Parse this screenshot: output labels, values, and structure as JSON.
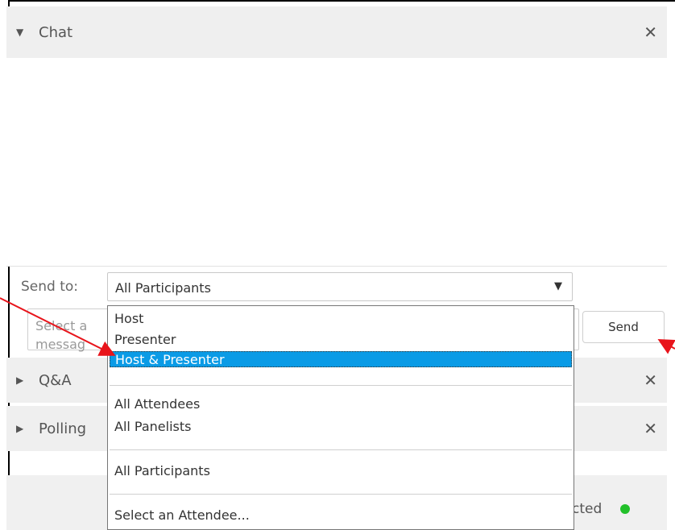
{
  "chat": {
    "title": "Chat",
    "send_to_label": "Send to:",
    "send_to_value": "All Participants",
    "message_placeholder_line1": "Select a",
    "message_placeholder_line2": "messag",
    "send_button": "Send"
  },
  "dropdown": {
    "items": [
      "Host",
      "Presenter",
      "Host & Presenter",
      "All Attendees",
      "All Panelists",
      "All Participants",
      "Select an Attendee..."
    ],
    "selected_item": "Host & Presenter"
  },
  "qa_panel": {
    "title": "Q&A"
  },
  "polling_panel": {
    "title": "Polling"
  },
  "status": {
    "text": "cted"
  },
  "icons": {
    "expanded": "triangle-down-icon",
    "collapsed": "triangle-right-icon",
    "close": "close-icon",
    "caret": "caret-down-icon",
    "status_dot": "status-dot-icon"
  },
  "colors": {
    "selection": "#0a9be6",
    "status_dot": "#22c02a",
    "annotation_arrow": "#e8141b"
  }
}
